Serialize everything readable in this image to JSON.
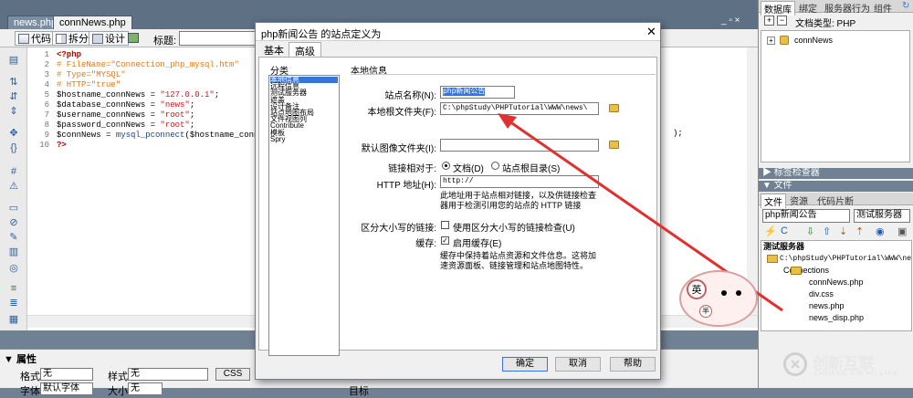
{
  "doc_tabs": [
    "news.php",
    "connNews.php"
  ],
  "window_controls": "_ ▫ ×",
  "toolbar": {
    "code": "代码",
    "split": "拆分",
    "design": "设计",
    "title_label": "标题:"
  },
  "code_lines": [
    {
      "n": "1",
      "segs": [
        [
          "c-red",
          "<?php"
        ]
      ]
    },
    {
      "n": "2",
      "segs": [
        [
          "c-cmt",
          "# FileName=\"Connection_php_mysql.htm\""
        ]
      ]
    },
    {
      "n": "3",
      "segs": [
        [
          "c-cmt",
          "# Type=\"MYSQL\""
        ]
      ]
    },
    {
      "n": "4",
      "segs": [
        [
          "c-cmt",
          "# HTTP=\"true\""
        ]
      ]
    },
    {
      "n": "5",
      "segs": [
        [
          "c-var",
          "$hostname_connNews = "
        ],
        [
          "c-str",
          "\"127.0.0.1\""
        ],
        [
          "c-var",
          ";"
        ]
      ]
    },
    {
      "n": "6",
      "segs": [
        [
          "c-var",
          "$database_connNews = "
        ],
        [
          "c-str",
          "\"news\""
        ],
        [
          "c-var",
          ";"
        ]
      ]
    },
    {
      "n": "7",
      "segs": [
        [
          "c-var",
          "$username_connNews = "
        ],
        [
          "c-str",
          "\"root\""
        ],
        [
          "c-var",
          ";"
        ]
      ]
    },
    {
      "n": "8",
      "segs": [
        [
          "c-var",
          "$password_connNews = "
        ],
        [
          "c-str",
          "\"root\""
        ],
        [
          "c-var",
          ";"
        ]
      ]
    },
    {
      "n": "9",
      "segs": [
        [
          "c-var",
          "$connNews = "
        ],
        [
          "c-fn",
          "mysql_pconnect"
        ],
        [
          "c-var",
          "($hostname_connNe"
        ]
      ]
    },
    {
      "n": "10",
      "segs": [
        [
          "c-red",
          "?>"
        ]
      ]
    }
  ],
  "code_tail": ");",
  "props": {
    "title": "▼ 属性",
    "format_label": "格式",
    "format_value": "无",
    "style_label": "样式",
    "style_value": "无",
    "css_button": "CSS",
    "font_label": "字体",
    "font_value": "默认字体",
    "size_label": "大小",
    "size_value": "无",
    "target_label": "目标"
  },
  "right_panel": {
    "tabs": [
      "数据库",
      "绑定",
      "服务器行为",
      "组件"
    ],
    "doc_type": "文档类型: PHP",
    "conn_node": "connNews",
    "tag_inspector": "▶ 标签检查器",
    "files_header": "▼ 文件",
    "files_tabs": [
      "文件",
      "资源",
      "代码片断"
    ],
    "site_select": "php新闻公告",
    "server_select": "测试服务器",
    "tree_root": "测试服务器",
    "tree": [
      "C:\\phpStudy\\PHPTutorial\\WWW\\news\\",
      "Connections",
      "connNews.php",
      "div.css",
      "news.php",
      "news_disp.php"
    ]
  },
  "dialog": {
    "title": "php新闻公告 的站点定义为",
    "tabs": [
      "基本",
      "高级"
    ],
    "category_label": "分类",
    "categories": [
      "本地信息",
      "远程信息",
      "测试服务器",
      "遮盖",
      "设计备注",
      "站点地图布局",
      "文件视图列",
      "Contribute",
      "模板",
      "Spry"
    ],
    "section_title": "本地信息",
    "site_name_label": "站点名称(N):",
    "site_name_value": "php新闻公告",
    "local_root_label": "本地根文件夹(F):",
    "local_root_value": "C:\\phpStudy\\PHPTutorial\\WWW\\news\\",
    "default_images_label": "默认图像文件夹(I):",
    "default_images_value": "",
    "links_relative_label": "链接相对于:",
    "radio_document": "文档(D)",
    "radio_site_root": "站点根目录(S)",
    "http_label": "HTTP 地址(H):",
    "http_value": "http://",
    "http_note": "此地址用于站点相对链接，以及供链接检查器用于检测引用您的站点的 HTTP 链接",
    "case_label": "区分大小写的链接:",
    "case_check": "使用区分大小写的链接检查(U)",
    "cache_label": "缓存:",
    "cache_check": "启用缓存(E)",
    "cache_note": "缓存中保持着站点资源和文件信息。这将加速资源面板、链接管理和站点地图特性。",
    "ok": "确定",
    "cancel": "取消",
    "help": "帮助"
  },
  "watermark": {
    "brand": "创新互联",
    "sub": "CHUANG XIN HU LIAN"
  },
  "colors": {
    "arrow": "#e03030",
    "selection": "#3875d7",
    "folder": "#e8c048"
  }
}
